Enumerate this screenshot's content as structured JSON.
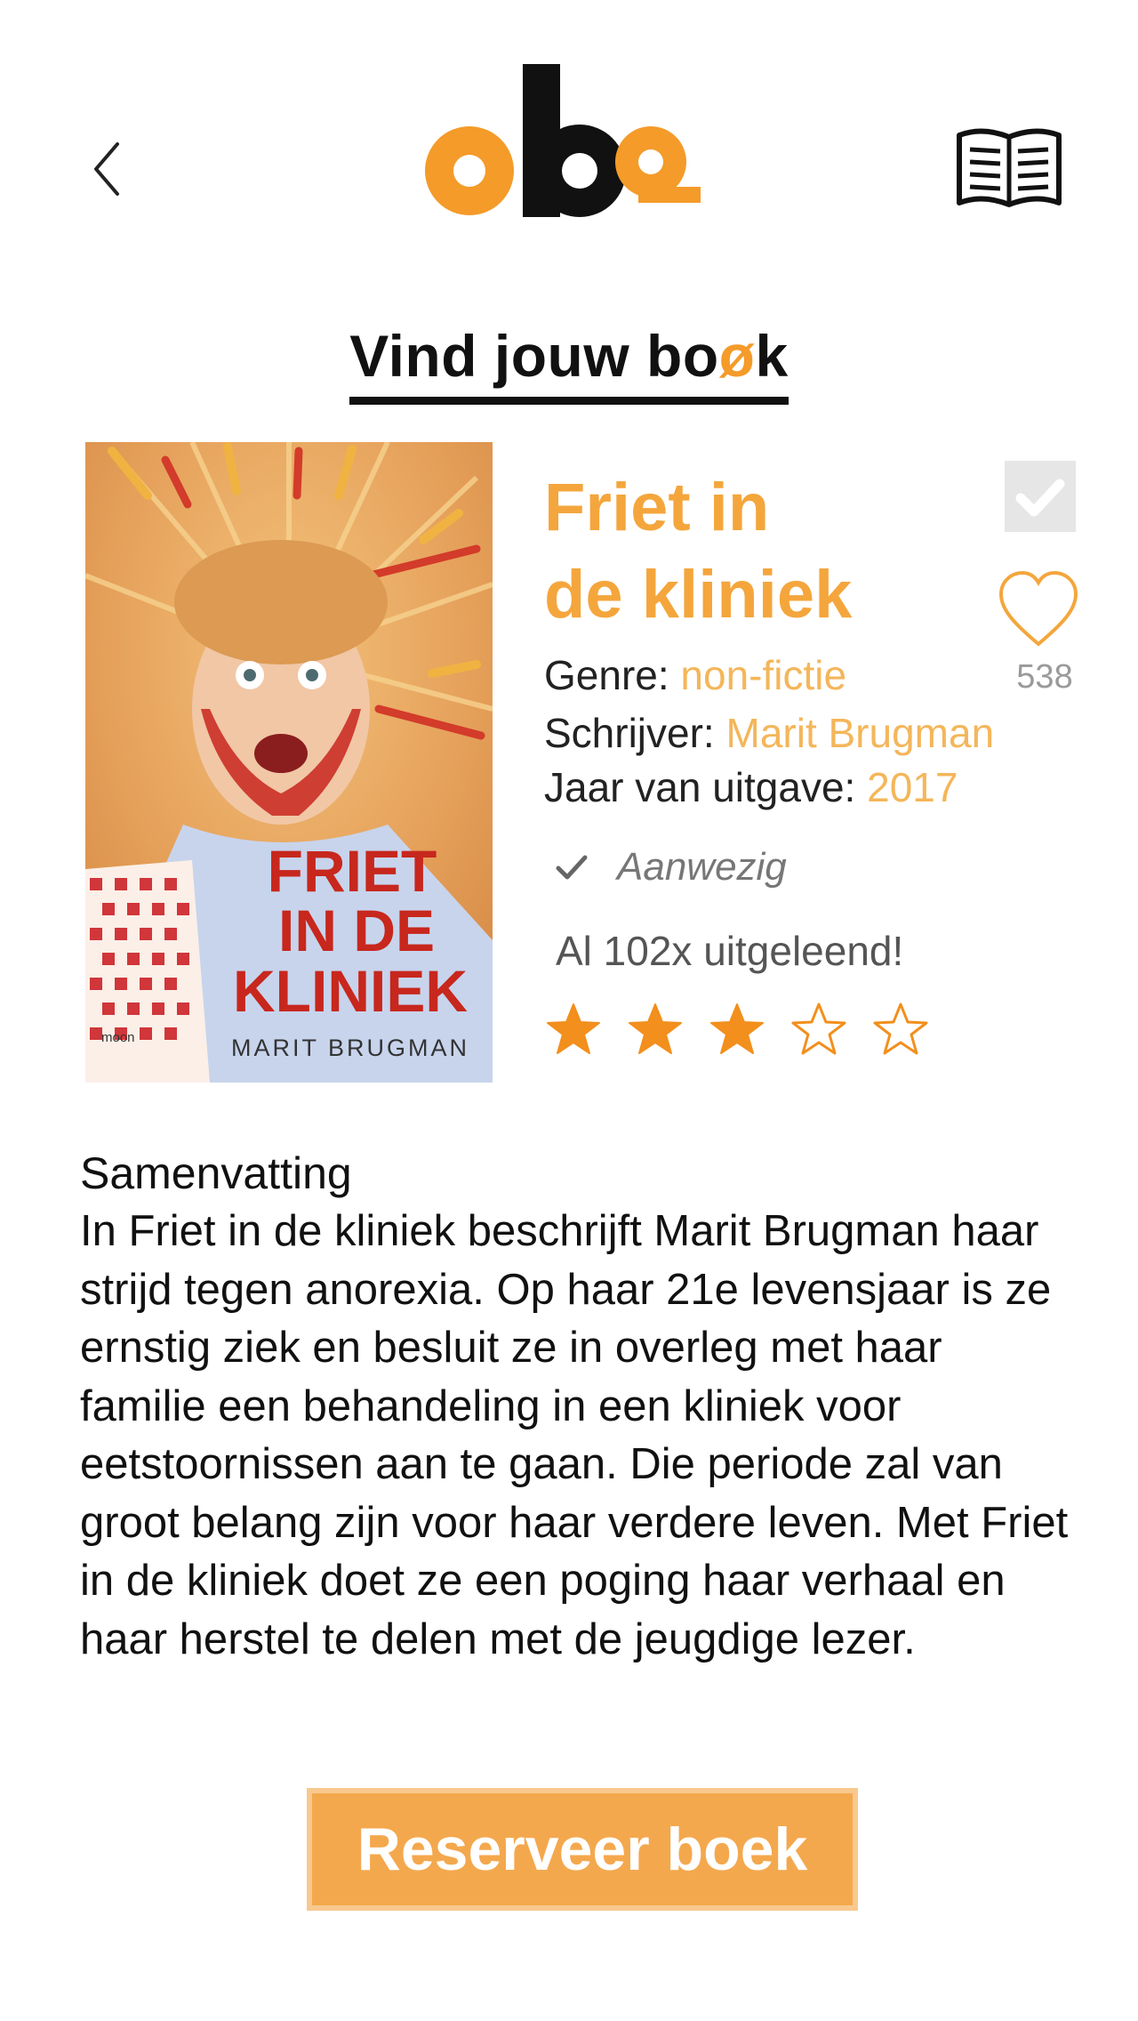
{
  "header": {
    "back_icon": "chevron-left-icon",
    "logo_text": "oba",
    "reader_icon": "open-book-icon"
  },
  "page": {
    "title_prefix": "Vind jouw bo",
    "title_accent": "ø",
    "title_suffix": "k"
  },
  "book": {
    "cover": {
      "title_lines": [
        "FRIET",
        "IN DE",
        "KLINIEK"
      ],
      "author": "MARIT BRUGMAN",
      "publisher": "moon"
    },
    "title_line1": "Friet in",
    "title_line2": "de kliniek",
    "genre_label": "Genre:",
    "genre": "non-fictie",
    "author_label": "Schrijver:",
    "author": "Marit Brugman",
    "year_label": "Jaar van uitgave:",
    "year": "2017",
    "likes": "538",
    "availability": "Aanwezig",
    "borrowed": "Al 102x uitgeleend!",
    "rating": 3,
    "rating_max": 5
  },
  "summary": {
    "title": "Samenvatting",
    "text": "In Friet in de kliniek beschrijft Marit Brugman haar strijd tegen anorexia. Op haar 21e levensjaar is ze ernstig ziek en besluit ze in overleg met haar familie een behandeling in een kliniek voor eetstoornissen aan te gaan. Die periode zal van groot belang zijn voor haar verdere leven. Met Friet in de kliniek doet ze een poging haar verhaal en haar herstel te delen met de jeugdige lezer."
  },
  "actions": {
    "reserve_label": "Reserveer boek"
  },
  "colors": {
    "accent": "#f49b2a",
    "title": "#f4a63c",
    "meta_value": "#f4b65a",
    "button": "#f4a84d",
    "star": "#f28f1d"
  }
}
